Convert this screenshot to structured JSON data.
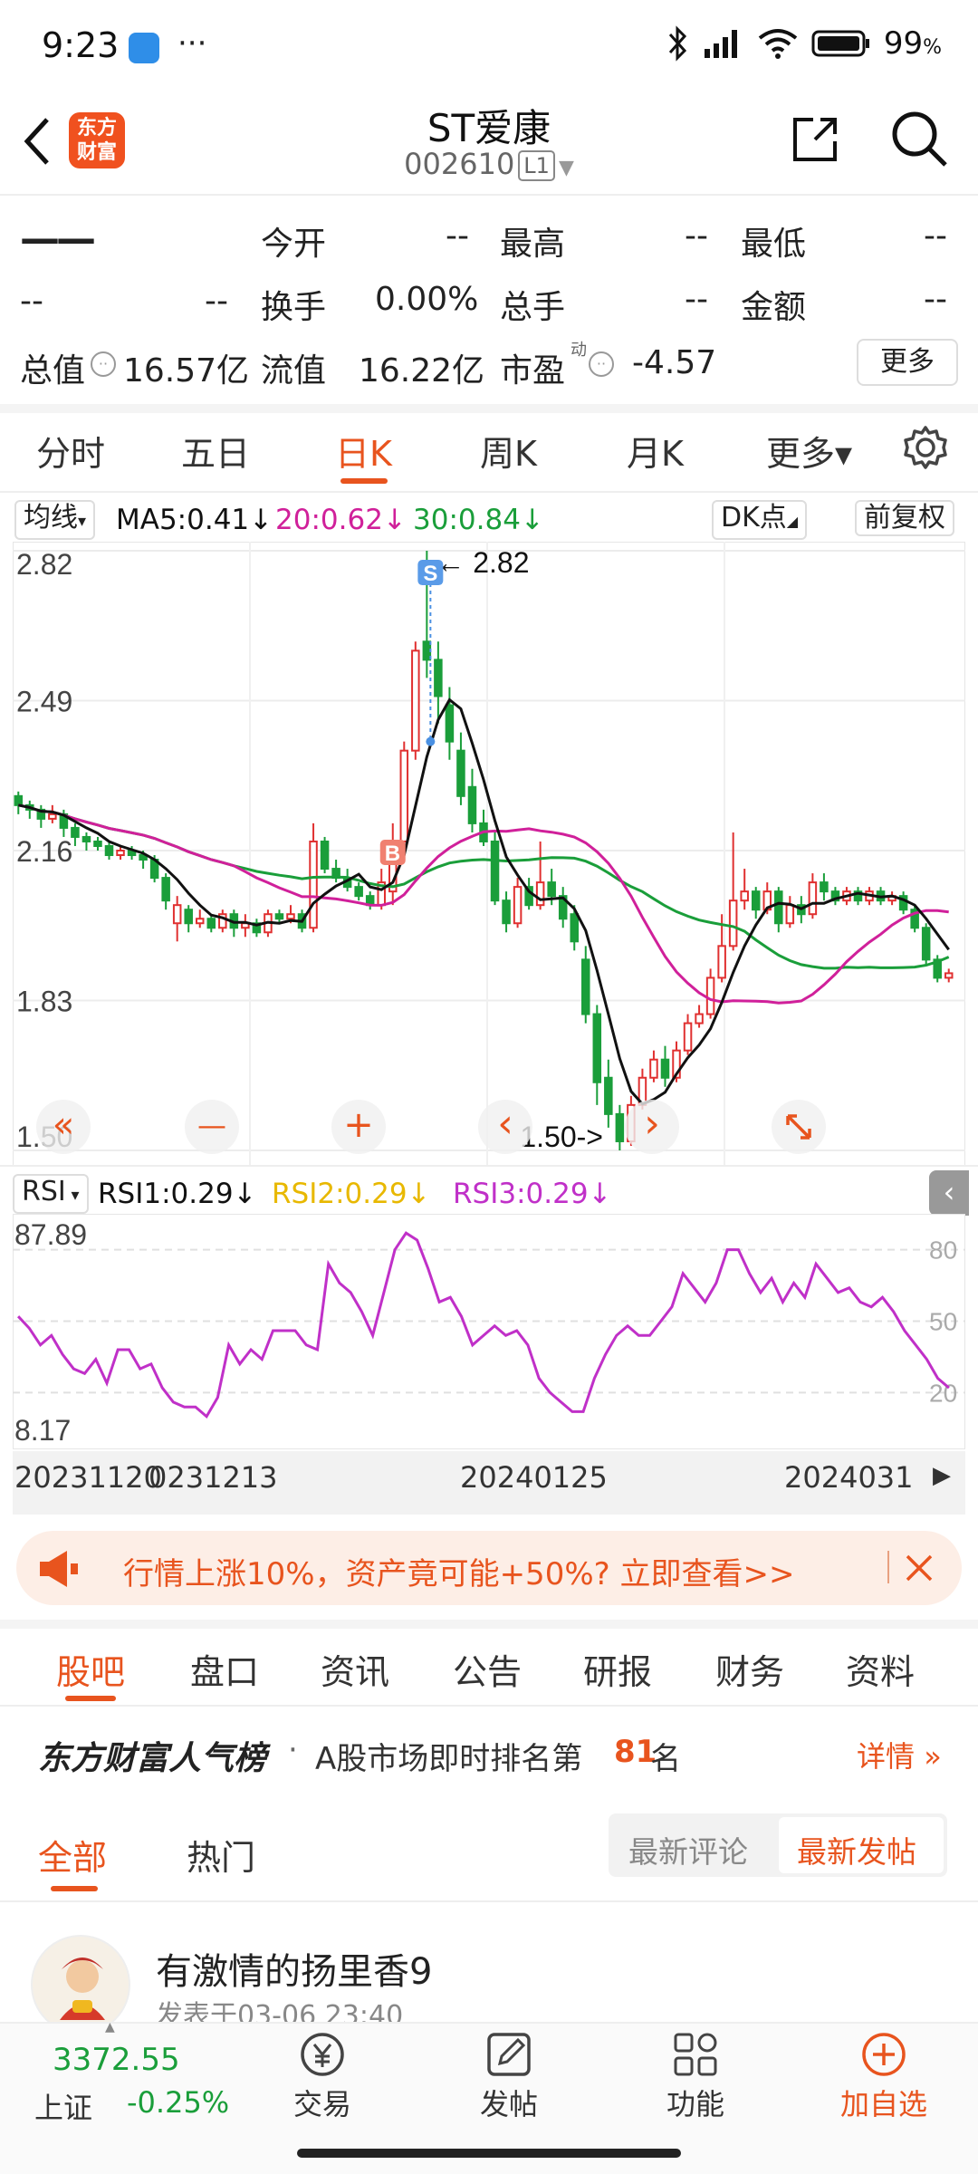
{
  "status_bar": {
    "time": "9:23",
    "battery": "99",
    "battery_unit": "%"
  },
  "header": {
    "title": "ST爱康",
    "code": "002610",
    "level": "L1",
    "logo_line1": "东方",
    "logo_line2": "财富"
  },
  "quote": {
    "price": "——",
    "change": "--",
    "change_pct": "--",
    "open_label": "今开",
    "open": "--",
    "high_label": "最高",
    "high": "--",
    "low_label": "最低",
    "low": "--",
    "turnover_label": "换手",
    "turnover": "0.00%",
    "volume_label": "总手",
    "volume": "--",
    "amount_label": "金额",
    "amount": "--",
    "mktcap_label": "总值",
    "mktcap": "16.57亿",
    "float_label": "流值",
    "float": "16.22亿",
    "pe_label": "市盈",
    "pe_sup": "动",
    "pe": "-4.57",
    "more_label": "更多"
  },
  "kline_tabs": [
    "分时",
    "五日",
    "日K",
    "周K",
    "月K",
    "更多▾"
  ],
  "ma_row": {
    "selector": "均线",
    "ma5": "MA5:0.41↓",
    "ma20": "20:0.62↓",
    "ma30": "30:0.84↓",
    "dk": "DK点",
    "adjust": "前复权"
  },
  "colors": {
    "accent": "#e8541e",
    "up": "#e03030",
    "down": "#1a9e3a",
    "ma5": "#111111",
    "ma20": "#d0209a",
    "ma30": "#1a9e3a",
    "rsi": "#c030c8",
    "rsi2": "#e8b800"
  },
  "chart_data": [
    {
      "type": "candlestick",
      "ylim": [
        1.5,
        2.82
      ],
      "yticks": [
        "2.82",
        "2.49",
        "2.16",
        "1.83",
        "1.50"
      ],
      "max_label": "2.82",
      "min_label": "1.50->",
      "buy_marker": "B",
      "sell_marker": "S",
      "candles": [
        [
          2.28,
          2.26,
          2.29,
          2.24
        ],
        [
          2.26,
          2.25,
          2.27,
          2.23
        ],
        [
          2.25,
          2.23,
          2.26,
          2.21
        ],
        [
          2.23,
          2.24,
          2.26,
          2.22
        ],
        [
          2.24,
          2.21,
          2.25,
          2.19
        ],
        [
          2.21,
          2.19,
          2.22,
          2.17
        ],
        [
          2.19,
          2.18,
          2.2,
          2.16
        ],
        [
          2.18,
          2.17,
          2.19,
          2.16
        ],
        [
          2.17,
          2.15,
          2.18,
          2.14
        ],
        [
          2.15,
          2.16,
          2.17,
          2.14
        ],
        [
          2.16,
          2.15,
          2.17,
          2.14
        ],
        [
          2.15,
          2.14,
          2.16,
          2.12
        ],
        [
          2.14,
          2.1,
          2.15,
          2.09
        ],
        [
          2.1,
          2.05,
          2.11,
          2.03
        ],
        [
          2.0,
          2.04,
          2.06,
          1.96
        ],
        [
          2.03,
          2.0,
          2.04,
          1.98
        ],
        [
          2.0,
          2.01,
          2.03,
          1.99
        ],
        [
          2.01,
          1.99,
          2.02,
          1.98
        ],
        [
          1.99,
          2.02,
          2.03,
          1.98
        ],
        [
          2.02,
          1.99,
          2.03,
          1.97
        ],
        [
          1.99,
          2.0,
          2.02,
          1.97
        ],
        [
          2.0,
          1.98,
          2.01,
          1.97
        ],
        [
          1.98,
          2.02,
          2.03,
          1.97
        ],
        [
          2.02,
          2.01,
          2.03,
          2.0
        ],
        [
          2.01,
          2.02,
          2.04,
          2.0
        ],
        [
          2.02,
          1.99,
          2.03,
          1.98
        ],
        [
          1.99,
          2.18,
          2.22,
          1.98
        ],
        [
          2.18,
          2.12,
          2.19,
          2.11
        ],
        [
          2.12,
          2.1,
          2.14,
          2.09
        ],
        [
          2.1,
          2.08,
          2.12,
          2.07
        ],
        [
          2.08,
          2.06,
          2.09,
          2.05
        ],
        [
          2.06,
          2.04,
          2.07,
          2.03
        ],
        [
          2.04,
          2.09,
          2.12,
          2.03
        ],
        [
          2.07,
          2.18,
          2.22,
          2.04
        ],
        [
          2.18,
          2.38,
          2.4,
          2.16
        ],
        [
          2.38,
          2.6,
          2.62,
          2.36
        ],
        [
          2.62,
          2.58,
          2.82,
          2.54
        ],
        [
          2.58,
          2.5,
          2.62,
          2.44
        ],
        [
          2.48,
          2.4,
          2.52,
          2.36
        ],
        [
          2.38,
          2.28,
          2.42,
          2.26
        ],
        [
          2.3,
          2.22,
          2.34,
          2.2
        ],
        [
          2.22,
          2.18,
          2.25,
          2.17
        ],
        [
          2.18,
          2.05,
          2.2,
          2.04
        ],
        [
          2.05,
          2.0,
          2.07,
          1.98
        ],
        [
          2.0,
          2.08,
          2.1,
          1.99
        ],
        [
          2.08,
          2.04,
          2.1,
          2.03
        ],
        [
          2.04,
          2.09,
          2.18,
          2.03
        ],
        [
          2.09,
          2.06,
          2.12,
          2.04
        ],
        [
          2.06,
          2.01,
          2.08,
          1.99
        ],
        [
          2.02,
          1.96,
          2.04,
          1.94
        ],
        [
          1.92,
          1.8,
          1.95,
          1.78
        ],
        [
          1.8,
          1.65,
          1.82,
          1.6
        ],
        [
          1.66,
          1.58,
          1.7,
          1.55
        ],
        [
          1.58,
          1.52,
          1.6,
          1.5
        ],
        [
          1.52,
          1.6,
          1.62,
          1.51
        ],
        [
          1.6,
          1.66,
          1.68,
          1.59
        ],
        [
          1.66,
          1.7,
          1.72,
          1.65
        ],
        [
          1.7,
          1.66,
          1.73,
          1.64
        ],
        [
          1.66,
          1.72,
          1.74,
          1.65
        ],
        [
          1.72,
          1.78,
          1.8,
          1.71
        ],
        [
          1.78,
          1.8,
          1.82,
          1.77
        ],
        [
          1.8,
          1.88,
          1.9,
          1.79
        ],
        [
          1.88,
          1.95,
          2.02,
          1.87
        ],
        [
          1.95,
          2.05,
          2.2,
          1.94
        ],
        [
          2.05,
          2.07,
          2.12,
          2.03
        ],
        [
          2.07,
          2.03,
          2.08,
          2.01
        ],
        [
          2.03,
          2.07,
          2.09,
          2.02
        ],
        [
          2.07,
          2.0,
          2.08,
          1.98
        ],
        [
          2.0,
          2.04,
          2.06,
          1.99
        ],
        [
          2.04,
          2.02,
          2.06,
          2.0
        ],
        [
          2.02,
          2.09,
          2.11,
          2.01
        ],
        [
          2.09,
          2.07,
          2.11,
          2.05
        ],
        [
          2.07,
          2.05,
          2.08,
          2.04
        ],
        [
          2.05,
          2.07,
          2.08,
          2.04
        ],
        [
          2.07,
          2.05,
          2.08,
          2.04
        ],
        [
          2.05,
          2.07,
          2.08,
          2.04
        ],
        [
          2.07,
          2.05,
          2.08,
          2.04
        ],
        [
          2.05,
          2.06,
          2.07,
          2.04
        ],
        [
          2.06,
          2.03,
          2.07,
          2.02
        ],
        [
          2.03,
          1.99,
          2.04,
          1.98
        ],
        [
          1.99,
          1.92,
          2.0,
          1.91
        ],
        [
          1.92,
          1.88,
          1.93,
          1.87
        ],
        [
          1.88,
          1.89,
          1.9,
          1.87
        ]
      ],
      "ma5_label": "MA5",
      "ma20_label": "MA20",
      "ma30_label": "MA30"
    },
    {
      "type": "line",
      "title": "RSI",
      "series_labels": [
        "RSI1:0.29↓",
        "RSI2:0.29↓",
        "RSI3:0.29↓"
      ],
      "ylim": [
        8.17,
        87.89
      ],
      "left_ticks": [
        "87.89",
        "8.17"
      ],
      "right_ticks": [
        "80",
        "50",
        "20"
      ],
      "x_labels": [
        "20231120",
        "0231213",
        "20240125",
        "2024031"
      ],
      "values": [
        52,
        47,
        40,
        44,
        36,
        30,
        28,
        34,
        24,
        38,
        38,
        30,
        32,
        22,
        16,
        14,
        14,
        10,
        18,
        40,
        32,
        38,
        34,
        46,
        46,
        46,
        40,
        38,
        74,
        66,
        62,
        54,
        44,
        62,
        80,
        87,
        84,
        72,
        58,
        60,
        52,
        40,
        44,
        48,
        44,
        46,
        40,
        26,
        20,
        16,
        12,
        12,
        26,
        36,
        44,
        48,
        44,
        44,
        50,
        56,
        70,
        64,
        58,
        66,
        80,
        80,
        70,
        62,
        68,
        58,
        66,
        60,
        74,
        68,
        62,
        64,
        58,
        56,
        60,
        54,
        46,
        40,
        34,
        26,
        22
      ]
    }
  ],
  "chart_controls": {
    "back": "«",
    "minus": "—",
    "plus": "+",
    "prev": "‹",
    "next": "›"
  },
  "rsi_row": {
    "selector": "RSI",
    "rsi1": "RSI1:0.29↓",
    "rsi2": "RSI2:0.29↓",
    "rsi3": "RSI3:0.29↓"
  },
  "banner": {
    "text": "行情上涨10%，资产竟可能+50%? 立即查看>>"
  },
  "feed_tabs": [
    "股吧",
    "盘口",
    "资讯",
    "公告",
    "研报",
    "财务",
    "资料"
  ],
  "ranking": {
    "brand": "东方财富人气榜",
    "dot": "·",
    "prefix": "A股市场即时排名第",
    "rank": "81",
    "suffix": "名",
    "detail": "详情"
  },
  "post_tabs": {
    "all": "全部",
    "hot": "热门",
    "latest_comment": "最新评论",
    "latest_post": "最新发帖"
  },
  "post": {
    "author": "有激情的扬里香9",
    "time": "发表于03-06 23:40"
  },
  "bottom_nav": {
    "index_value": "3372.55",
    "index_name": "上证",
    "index_change": "-0.25%",
    "trade": "交易",
    "post": "发帖",
    "func": "功能",
    "add": "加自选"
  }
}
